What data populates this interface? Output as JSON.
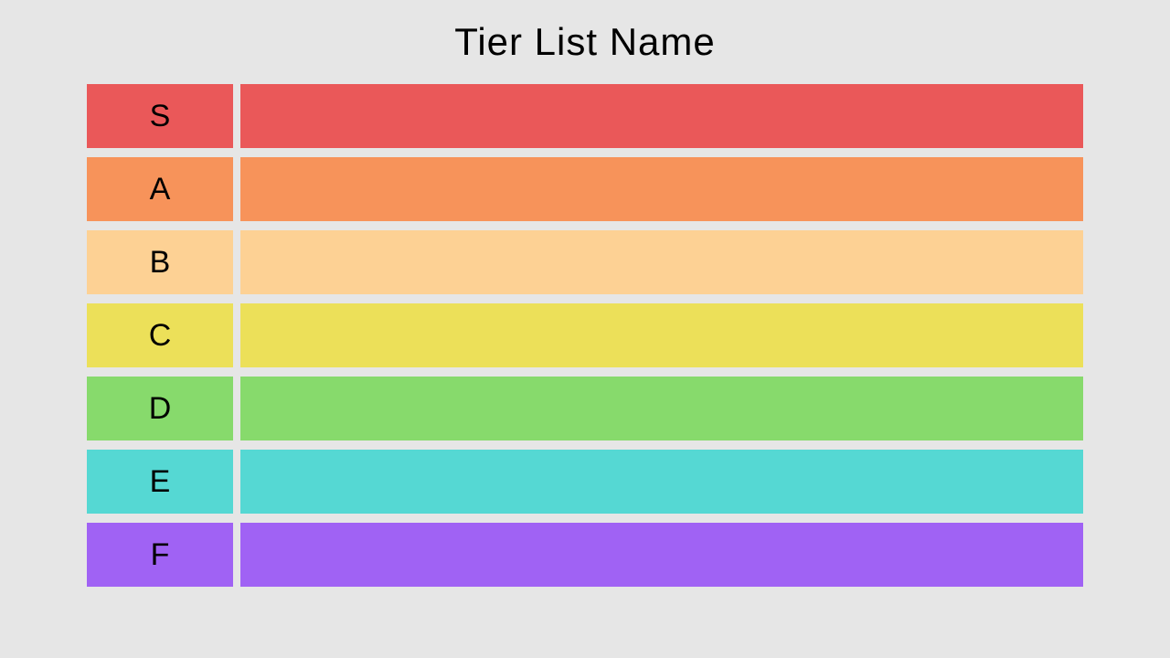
{
  "title": "Tier List Name",
  "tiers": [
    {
      "label": "S",
      "color": "#ea5859"
    },
    {
      "label": "A",
      "color": "#f7935a"
    },
    {
      "label": "B",
      "color": "#fdd194"
    },
    {
      "label": "C",
      "color": "#ece059"
    },
    {
      "label": "D",
      "color": "#87da6c"
    },
    {
      "label": "E",
      "color": "#55d8d3"
    },
    {
      "label": "F",
      "color": "#a062f4"
    }
  ]
}
